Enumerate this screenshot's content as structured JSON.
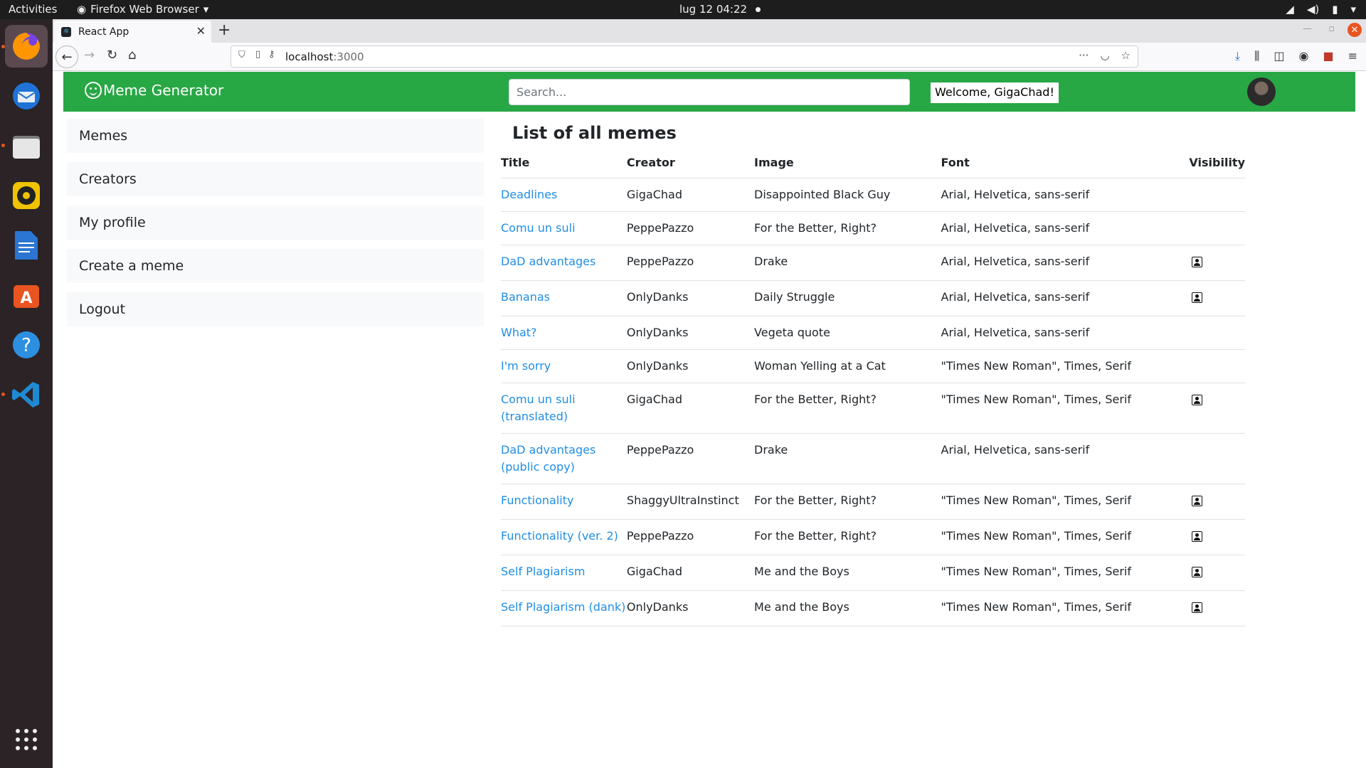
{
  "system": {
    "activities": "Activities",
    "app_menu": "Firefox Web Browser",
    "clock": "lug 12  04:22"
  },
  "browser": {
    "tab_title": "React App",
    "url_host": "localhost",
    "url_port": ":3000"
  },
  "app": {
    "brand": "Meme Generator",
    "search_placeholder": "Search...",
    "welcome": "Welcome, GigaChad!",
    "nav_color": "#28a745"
  },
  "sidebar": {
    "items": [
      {
        "label": "Memes"
      },
      {
        "label": "Creators"
      },
      {
        "label": "My profile"
      },
      {
        "label": "Create a meme"
      },
      {
        "label": "Logout"
      }
    ]
  },
  "main": {
    "heading": "List of all memes",
    "columns": [
      "Title",
      "Creator",
      "Image",
      "Font",
      "Visibility"
    ],
    "rows": [
      {
        "title": "Deadlines",
        "creator": "GigaChad",
        "image": "Disappointed Black Guy",
        "font": "Arial, Helvetica, sans-serif",
        "protected": false
      },
      {
        "title": "Comu un suli",
        "creator": "PeppePazzo",
        "image": "For the Better, Right?",
        "font": "Arial, Helvetica, sans-serif",
        "protected": false
      },
      {
        "title": "DaD advantages",
        "creator": "PeppePazzo",
        "image": "Drake",
        "font": "Arial, Helvetica, sans-serif",
        "protected": true
      },
      {
        "title": "Bananas",
        "creator": "OnlyDanks",
        "image": "Daily Struggle",
        "font": "Arial, Helvetica, sans-serif",
        "protected": true
      },
      {
        "title": "What?",
        "creator": "OnlyDanks",
        "image": "Vegeta quote",
        "font": "Arial, Helvetica, sans-serif",
        "protected": false
      },
      {
        "title": "I'm sorry",
        "creator": "OnlyDanks",
        "image": "Woman Yelling at a Cat",
        "font": "\"Times New Roman\", Times, Serif",
        "protected": false
      },
      {
        "title": "Comu un suli (translated)",
        "creator": "GigaChad",
        "image": "For the Better, Right?",
        "font": "\"Times New Roman\", Times, Serif",
        "protected": true
      },
      {
        "title": "DaD advantages (public copy)",
        "creator": "PeppePazzo",
        "image": "Drake",
        "font": "Arial, Helvetica, sans-serif",
        "protected": false
      },
      {
        "title": "Functionality",
        "creator": "ShaggyUltraInstinct",
        "image": "For the Better, Right?",
        "font": "\"Times New Roman\", Times, Serif",
        "protected": true
      },
      {
        "title": "Functionality (ver. 2)",
        "creator": "PeppePazzo",
        "image": "For the Better, Right?",
        "font": "\"Times New Roman\", Times, Serif",
        "protected": true
      },
      {
        "title": "Self Plagiarism",
        "creator": "GigaChad",
        "image": "Me and the Boys",
        "font": "\"Times New Roman\", Times, Serif",
        "protected": true
      },
      {
        "title": "Self Plagiarism (dank)",
        "creator": "OnlyDanks",
        "image": "Me and the Boys",
        "font": "\"Times New Roman\", Times, Serif",
        "protected": true
      }
    ]
  }
}
